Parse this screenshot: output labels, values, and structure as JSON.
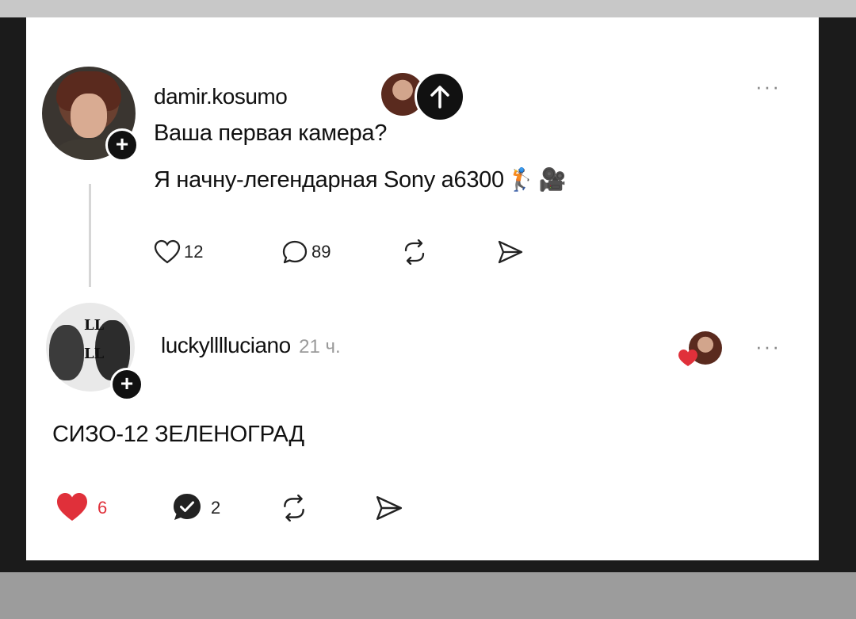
{
  "post": {
    "username": "damir.kosumo",
    "lines": [
      "Ваша первая камера?",
      "Я начну-легендарная Sony a6300"
    ],
    "emoji": [
      "🏌",
      "🎥"
    ],
    "likes": "12",
    "comments": "89",
    "more": "···"
  },
  "reply": {
    "username": "luckylllluciano",
    "time": "21 ч.",
    "avatar_text": [
      "LL",
      "LL"
    ],
    "text": "СИЗО-12 ЗЕЛЕНОГРАД",
    "likes": "6",
    "comments": "2",
    "more": "···"
  },
  "colors": {
    "like_red": "#e0303a",
    "text": "#111111",
    "muted": "#9a9a9a"
  }
}
